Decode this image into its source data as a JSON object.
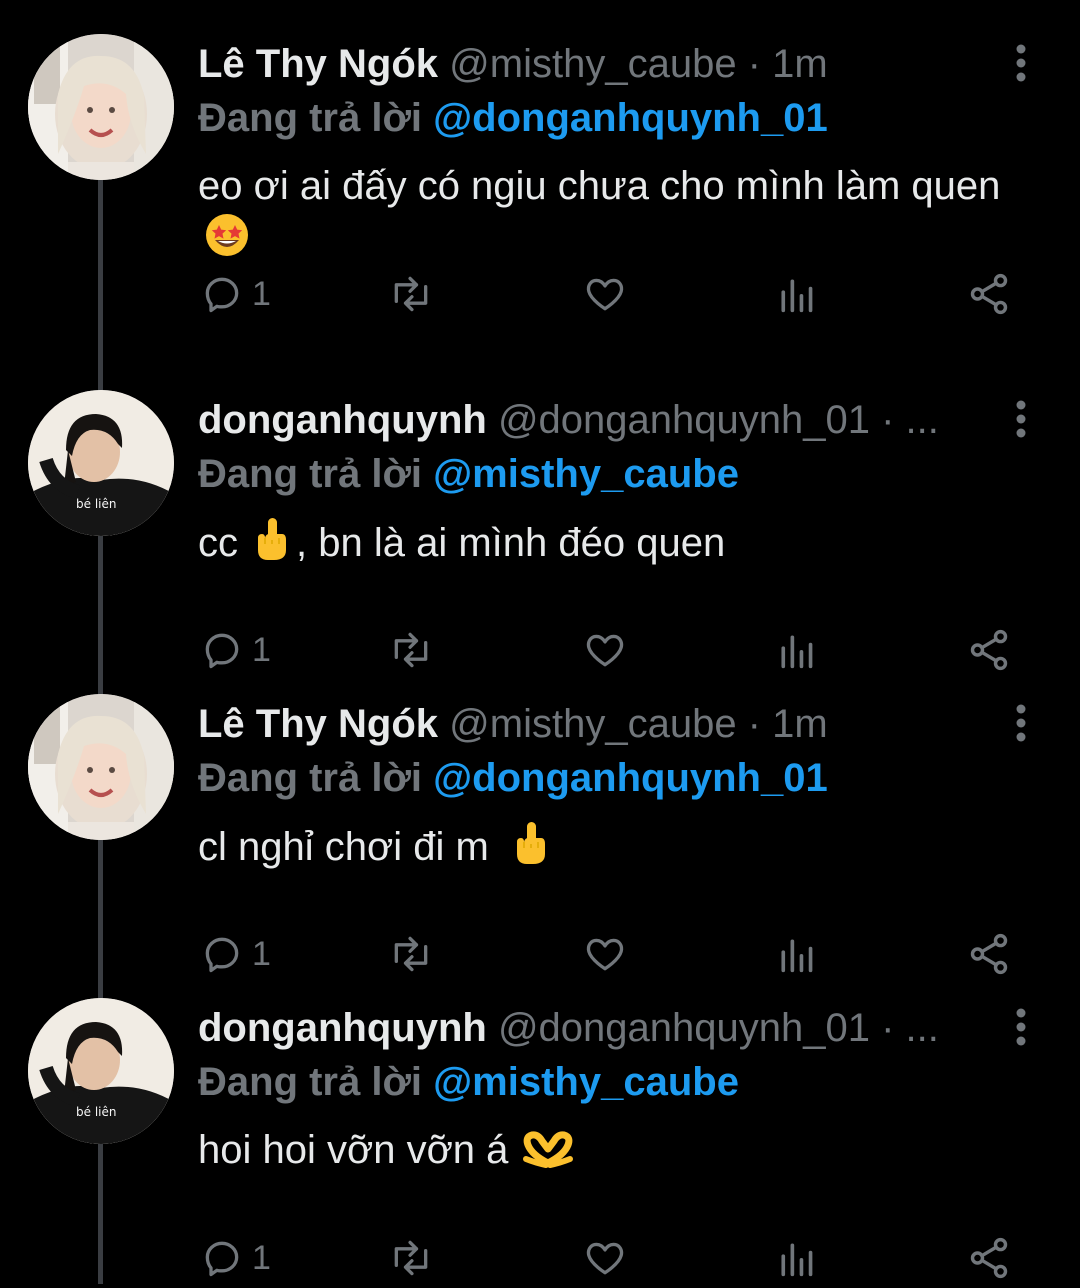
{
  "tweets": [
    {
      "display_name": "Lê Thy Ngók",
      "meta": "@misthy_caube · 1m",
      "replying_prefix": "Đang trả lời",
      "replying_to": "@donganhquynh_01",
      "text": "eo ơi ai đấy có ngiu chưa cho mình làm quen",
      "emoji": "star-struck-emoji",
      "reply_count": "1",
      "avatar": "misthy-avatar"
    },
    {
      "display_name": "donganhquynh",
      "meta": "@donganhquynh_01 · ...",
      "replying_prefix": "Đang trả lời",
      "replying_to": "@misthy_caube",
      "text_before": "cc",
      "text_after": ", bn là ai mình đéo quen",
      "emoji": "middle-finger-emoji",
      "reply_count": "1",
      "avatar": "donganhquynh-avatar",
      "avatar_shirt_text": "bé liên"
    },
    {
      "display_name": "Lê Thy Ngók",
      "meta": "@misthy_caube · 1m",
      "replying_prefix": "Đang trả lời",
      "replying_to": "@donganhquynh_01",
      "text": "cl nghỉ chơi đi m",
      "emoji": "middle-finger-emoji",
      "reply_count": "1",
      "avatar": "misthy-avatar"
    },
    {
      "display_name": "donganhquynh",
      "meta": "@donganhquynh_01 · ...",
      "replying_prefix": "Đang trả lời",
      "replying_to": "@misthy_caube",
      "text": "hoi hoi vỡn vỡn á",
      "emoji": "heart-hands-emoji",
      "reply_count": "1",
      "avatar": "donganhquynh-avatar",
      "avatar_shirt_text": "bé liên"
    }
  ],
  "icons": {
    "reply": "reply-icon",
    "retweet": "retweet-icon",
    "like": "heart-icon",
    "views": "views-icon",
    "share": "share-icon",
    "more": "more-vertical-icon"
  },
  "colors": {
    "background": "#000000",
    "text": "#e7e9ea",
    "muted": "#71767b",
    "link": "#1d9bf0",
    "thread_line": "#3a3d42"
  }
}
